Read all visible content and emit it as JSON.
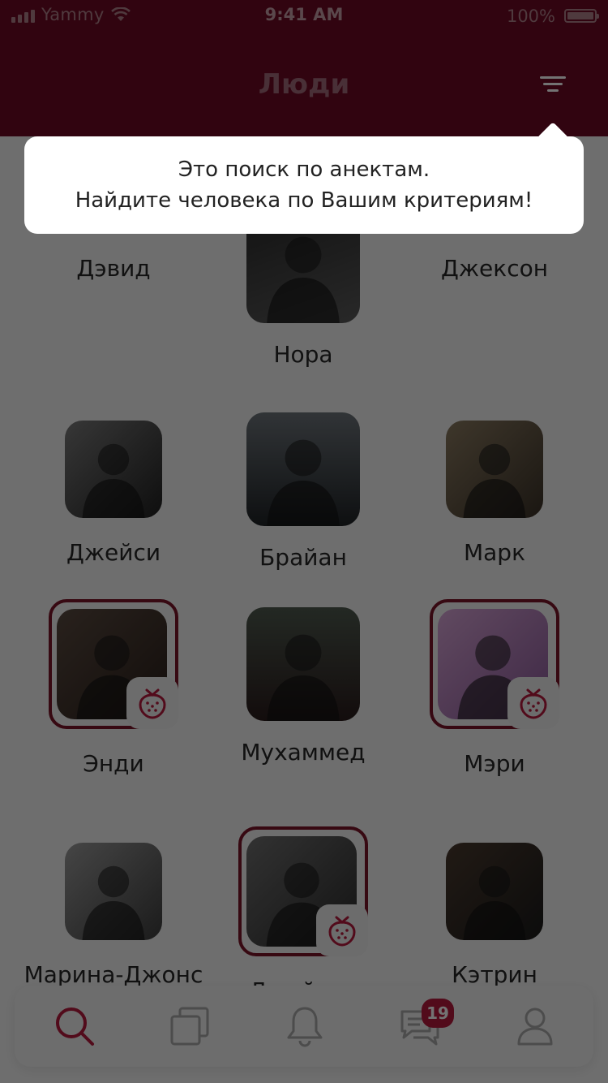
{
  "status_bar": {
    "carrier": "Yammy",
    "time": "9:41 AM",
    "battery": "100%"
  },
  "header": {
    "title": "Люди",
    "filter_icon": "filter-lines-icon"
  },
  "tooltip": {
    "line1": "Это поиск по анектам.",
    "line2": "Найдите человека по Вашим критериям!"
  },
  "people": [
    {
      "name": "Дэвид",
      "featured": true
    },
    {
      "name": "Нора",
      "featured": false
    },
    {
      "name": "Джексон",
      "featured": true
    },
    {
      "name": "Джейси",
      "featured": false
    },
    {
      "name": "Брайан",
      "featured": false
    },
    {
      "name": "Марк",
      "featured": false
    },
    {
      "name": "Энди",
      "featured": true
    },
    {
      "name": "Мухаммед",
      "featured": false
    },
    {
      "name": "Мэри",
      "featured": true
    },
    {
      "name": "Марина-Джонс",
      "featured": false
    },
    {
      "name": "Джейсон",
      "featured": true
    },
    {
      "name": "Кэтрин",
      "featured": false
    }
  ],
  "tab_bar": {
    "tabs": [
      "search-icon",
      "cards-icon",
      "bell-icon",
      "chat-icon",
      "profile-icon"
    ],
    "chat_badge": "19",
    "active_color": "#b51a3c",
    "inactive_color": "#a8a8a8"
  },
  "colors": {
    "brand": "#7a1429",
    "header": "#6e0a24"
  }
}
